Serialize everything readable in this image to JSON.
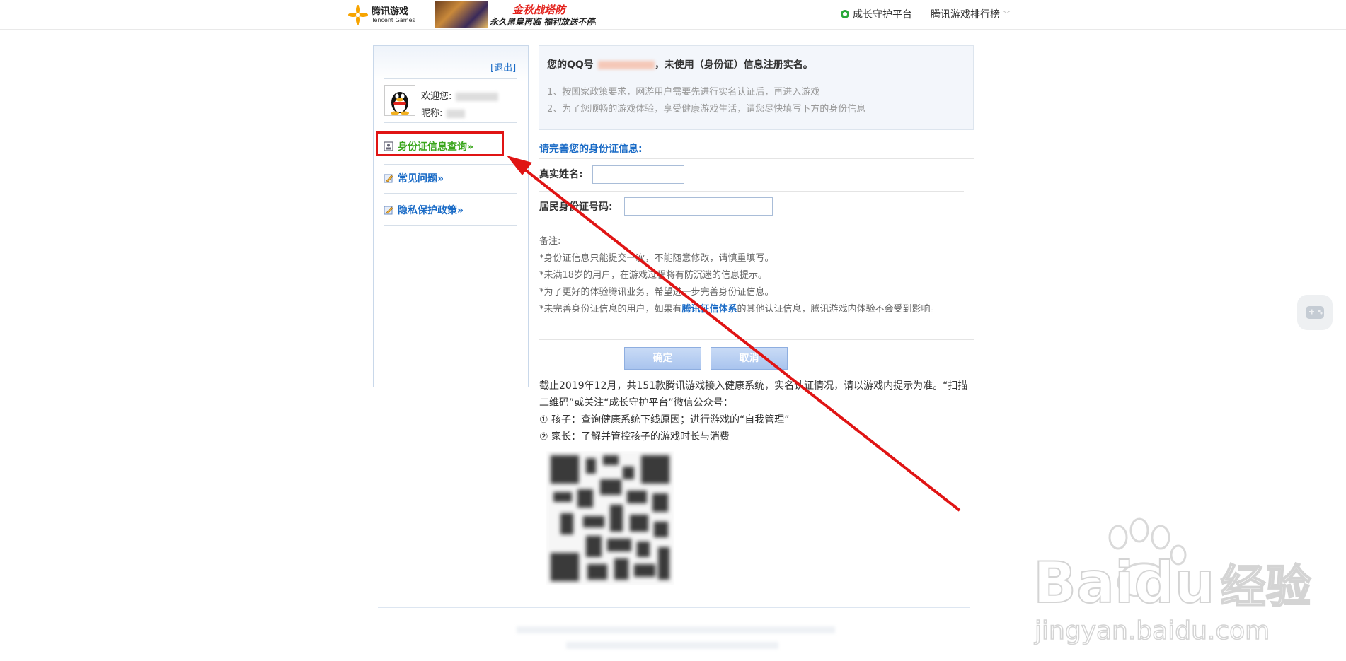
{
  "header": {
    "logo_cn": "腾讯游戏",
    "logo_en": "Tencent Games",
    "banner_title": "金秋战塔防",
    "banner_sub": "永久黑皇再临 福利放送不停歇",
    "links": [
      "成长守护平台",
      "腾讯游戏排行榜"
    ]
  },
  "sidebar": {
    "logout": "[退出]",
    "welcome": "欢迎您:",
    "nickname": "昵称:",
    "items": [
      {
        "label": "身份证信息查询»",
        "active": true
      },
      {
        "label": "常见问题»",
        "active": false
      },
      {
        "label": "隐私保护政策»",
        "active": false
      }
    ]
  },
  "notice": {
    "title_prefix": "您的QQ号",
    "title_suffix": "，未使用（身份证）信息注册实名。",
    "lines": [
      "1、按国家政策要求，网游用户需要先进行实名认证后，再进入游戏",
      "2、为了您顺畅的游戏体验，享受健康游戏生活，请您尽快填写下方的身份信息"
    ]
  },
  "form": {
    "heading": "请完善您的身份证信息:",
    "name_label": "真实姓名:",
    "name_value": "",
    "id_label": "居民身份证号码:",
    "id_value": "",
    "remarks_title": "备注:",
    "remarks": [
      "*身份证信息只能提交一次，不能随意修改，请慎重填写。",
      "*未满18岁的用户，在游戏过程将有防沉迷的信息提示。",
      "*为了更好的体验腾讯业务，希望进一步完善身份证信息。"
    ],
    "remark4_prefix": "*未完善身份证信息的用户，如果有",
    "remark4_link": "腾讯征信体系",
    "remark4_suffix": "的其他认证信息，腾讯游戏内体验不会受到影响。",
    "confirm": "确定",
    "cancel": "取消"
  },
  "info": {
    "lines": [
      "截止2019年12月，共151款腾讯游戏接入健康系统，实名认证情况，请以游戏内提示为准。“扫描二维码”或关注“成长守护平台”微信公众号：",
      "① 孩子：查询健康系统下线原因；进行游戏的“自我管理”",
      "② 家长：了解并管控孩子的游戏时长与消费"
    ]
  },
  "watermark": {
    "brand": "Bai",
    "brand2": "du",
    "cn": "经验",
    "url": "jingyan.baidu.com"
  },
  "colors": {
    "link_blue": "#1a6bc6",
    "active_green": "#3aa61c",
    "highlight_red": "#e01414"
  }
}
